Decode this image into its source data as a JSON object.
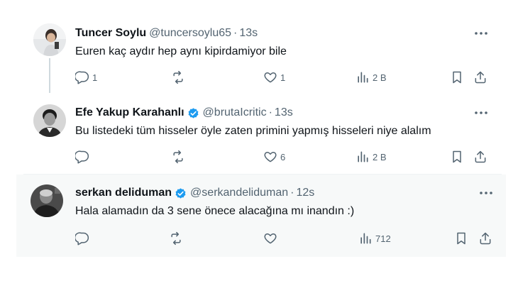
{
  "colors": {
    "text_primary": "#0f1419",
    "text_secondary": "#536471",
    "verified_blue": "#1d9bf0",
    "highlight_bg": "#f7f9f9"
  },
  "tweets": [
    {
      "name": "Tuncer Soylu",
      "handle": "@tuncersoylu65",
      "dot": "·",
      "time": "13s",
      "verified": false,
      "text": "Euren kaç aydır hep aynı kipirdamiyor bile",
      "reply_count": "1",
      "retweet_count": "",
      "like_count": "1",
      "view_count": "2 B"
    },
    {
      "name": "Efe Yakup Karahanlı",
      "handle": "@brutaIcritic",
      "dot": "·",
      "time": "13s",
      "verified": true,
      "text": "Bu listedeki tüm hisseler öyle zaten primini yapmış hisseleri niye alalım",
      "reply_count": "",
      "retweet_count": "",
      "like_count": "6",
      "view_count": "2 B"
    },
    {
      "name": "serkan deliduman",
      "handle": "@serkandeliduman",
      "dot": "·",
      "time": "12s",
      "verified": true,
      "text": "Hala alamadın da 3 sene önece alacağına mı inandın :)",
      "reply_count": "",
      "retweet_count": "",
      "like_count": "",
      "view_count": "712"
    }
  ],
  "icons": {
    "reply": "reply-icon",
    "retweet": "retweet-icon",
    "like": "heart-icon",
    "views": "views-icon",
    "bookmark": "bookmark-icon",
    "share": "share-icon",
    "more": "more-icon",
    "verified": "verified-badge-icon"
  }
}
